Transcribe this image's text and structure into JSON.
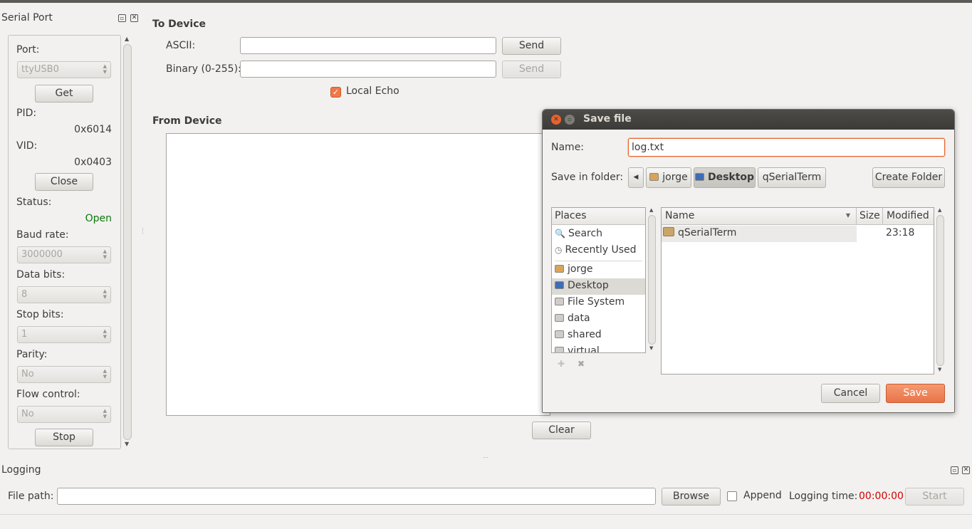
{
  "serial_port": {
    "title": "Serial Port",
    "port_label": "Port:",
    "port_value": "ttyUSB0",
    "get_label": "Get",
    "pid_label": "PID:",
    "pid_value": "0x6014",
    "vid_label": "VID:",
    "vid_value": "0x0403",
    "close_label": "Close",
    "status_label": "Status:",
    "status_value": "Open",
    "baud_label": "Baud rate:",
    "baud_value": "3000000",
    "databits_label": "Data bits:",
    "databits_value": "8",
    "stopbits_label": "Stop bits:",
    "stopbits_value": "1",
    "parity_label": "Parity:",
    "parity_value": "No",
    "flow_label": "Flow control:",
    "flow_value": "No",
    "stop_label": "Stop"
  },
  "to_device": {
    "title": "To Device",
    "ascii_label": "ASCII:",
    "ascii_value": "",
    "binary_label": "Binary (0-255):",
    "binary_value": "",
    "send_label": "Send",
    "send2_label": "Send",
    "local_echo_label": "Local Echo",
    "local_echo_checked": true
  },
  "from_device": {
    "title": "From Device",
    "clear_label": "Clear"
  },
  "save_dialog": {
    "title": "Save file",
    "name_label": "Name:",
    "name_value": "log.txt",
    "folder_label": "Save in folder:",
    "path": [
      "jorge",
      "Desktop",
      "qSerialTerm"
    ],
    "create_folder_label": "Create Folder",
    "places_header": "Places",
    "places": [
      "Search",
      "Recently Used",
      "jorge",
      "Desktop",
      "File System",
      "data",
      "shared",
      "virtual"
    ],
    "files_headers": {
      "name": "Name",
      "size": "Size",
      "modified": "Modified"
    },
    "files": [
      {
        "name": "qSerialTerm",
        "size": "",
        "modified": "23:18"
      }
    ],
    "cancel_label": "Cancel",
    "save_label": "Save"
  },
  "logging": {
    "title": "Logging",
    "filepath_label": "File path:",
    "filepath_value": "",
    "browse_label": "Browse",
    "append_label": "Append",
    "logging_time_label": "Logging time:",
    "logging_time_value": "00:00:00",
    "start_label": "Start"
  },
  "colors": {
    "status_open": "#0b7a0b",
    "logging_time": "#d40000",
    "accent": "#f07746"
  }
}
